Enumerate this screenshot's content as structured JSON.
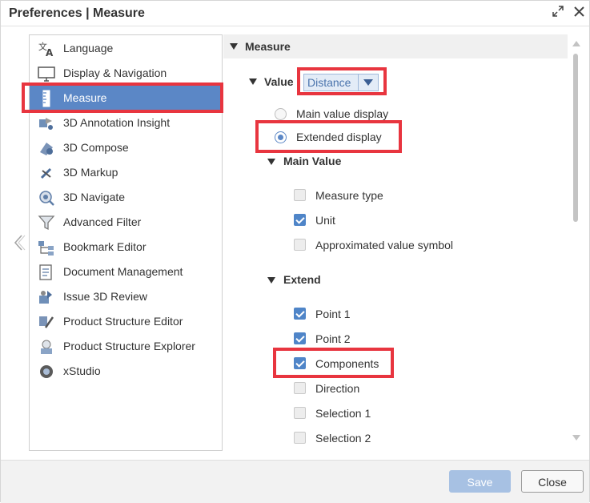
{
  "window": {
    "title": "Preferences | Measure",
    "maximize_icon": "expand-icon",
    "close_icon": "close-icon"
  },
  "nav": {
    "items": [
      {
        "label": "Language",
        "icon": "language-icon"
      },
      {
        "label": "Display & Navigation",
        "icon": "monitor-icon"
      },
      {
        "label": "Measure",
        "icon": "ruler-icon",
        "selected": true
      },
      {
        "label": "3D Annotation Insight",
        "icon": "annotation-icon"
      },
      {
        "label": "3D Compose",
        "icon": "compose-icon"
      },
      {
        "label": "3D Markup",
        "icon": "markup-icon"
      },
      {
        "label": "3D Navigate",
        "icon": "navigate-icon"
      },
      {
        "label": "Advanced Filter",
        "icon": "filter-icon"
      },
      {
        "label": "Bookmark Editor",
        "icon": "bookmark-icon"
      },
      {
        "label": "Document Management",
        "icon": "document-icon"
      },
      {
        "label": "Issue 3D Review",
        "icon": "issue-review-icon"
      },
      {
        "label": "Product Structure Editor",
        "icon": "structure-editor-icon"
      },
      {
        "label": "Product Structure Explorer",
        "icon": "structure-explorer-icon"
      },
      {
        "label": "xStudio",
        "icon": "xstudio-icon"
      }
    ]
  },
  "panel": {
    "section_title": "Measure",
    "value_label": "Value",
    "value_dropdown": "Distance",
    "radios": [
      {
        "label": "Main value display",
        "checked": false
      },
      {
        "label": "Extended display",
        "checked": true
      }
    ],
    "main_value": {
      "title": "Main Value",
      "options": [
        {
          "label": "Measure type",
          "checked": false
        },
        {
          "label": "Unit",
          "checked": true
        },
        {
          "label": "Approximated value symbol",
          "checked": false
        }
      ]
    },
    "extend": {
      "title": "Extend",
      "options": [
        {
          "label": "Point 1",
          "checked": true
        },
        {
          "label": "Point 2",
          "checked": true
        },
        {
          "label": "Components",
          "checked": true
        },
        {
          "label": "Direction",
          "checked": false
        },
        {
          "label": "Selection 1",
          "checked": false
        },
        {
          "label": "Selection 2",
          "checked": false
        }
      ]
    }
  },
  "footer": {
    "save_label": "Save",
    "close_label": "Close"
  },
  "colors": {
    "accent": "#5b87c6",
    "highlight": "#e8353f"
  }
}
